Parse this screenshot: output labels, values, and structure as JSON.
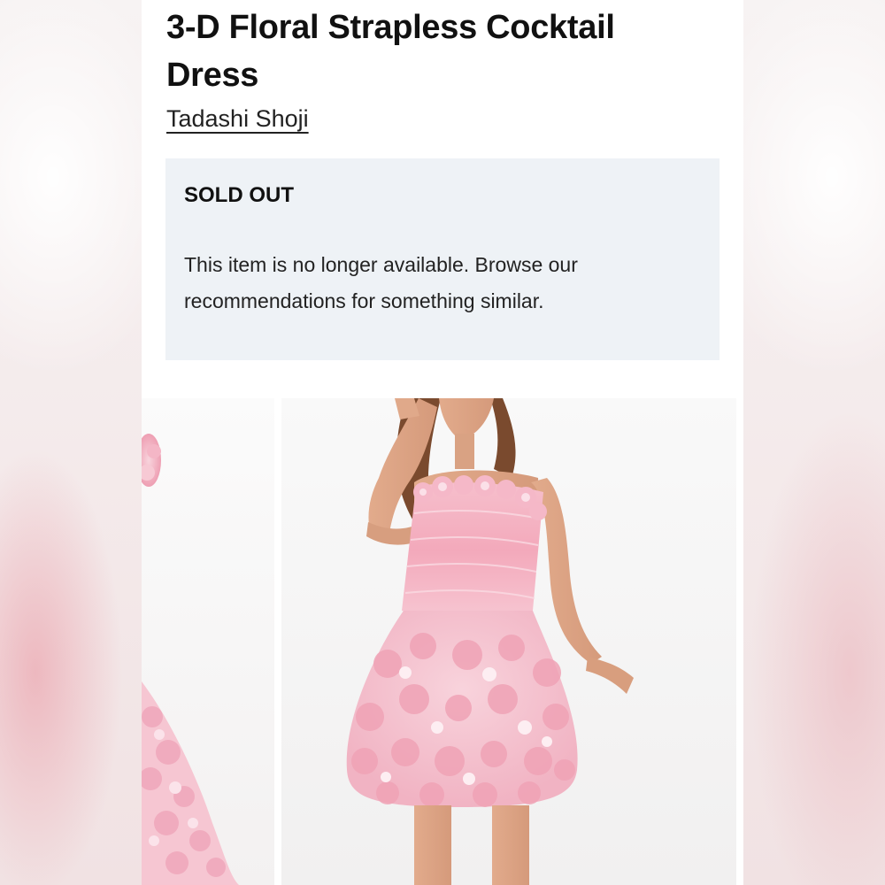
{
  "product": {
    "title": "3-D Floral Strapless Cocktail Dress",
    "brand": "Tadashi Shoji"
  },
  "availability": {
    "status_heading": "SOLD OUT",
    "message": "This item is no longer available. Browse our recommendations for something similar."
  },
  "gallery": {
    "images": [
      {
        "name": "product-image-side",
        "description_icon": "dress-photo"
      },
      {
        "name": "product-image-front",
        "description_icon": "dress-photo"
      }
    ]
  },
  "colors": {
    "notice_background": "#eef2f6",
    "dress_pink": "#f2b8c6",
    "page_background": "#ffffff"
  }
}
